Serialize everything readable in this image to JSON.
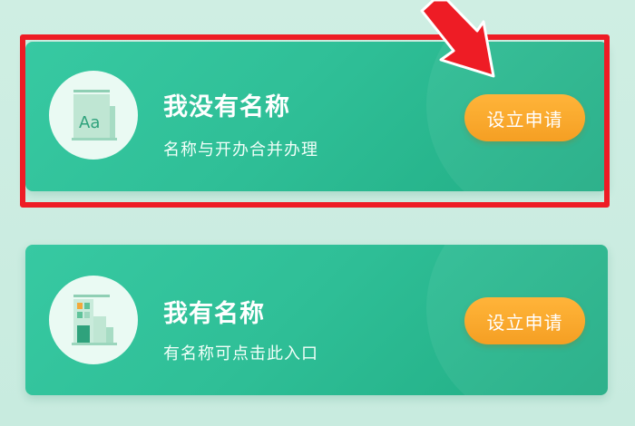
{
  "options": [
    {
      "title": "我没有名称",
      "subtitle": "名称与开办合并办理",
      "button_label": "设立申请",
      "icon": "font-document-icon"
    },
    {
      "title": "我有名称",
      "subtitle": "有名称可点击此入口",
      "button_label": "设立申请",
      "icon": "building-icon"
    }
  ],
  "colors": {
    "card_green": "#2fbf97",
    "button_orange": "#f7a21c",
    "annotation_red": "#ee1c25",
    "icon_bg": "#eafaf3"
  }
}
